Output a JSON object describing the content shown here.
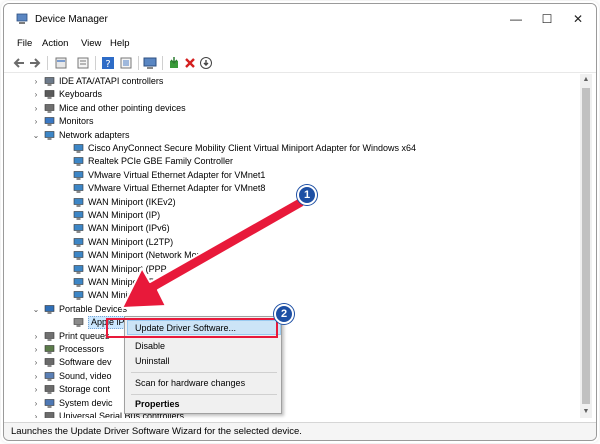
{
  "window": {
    "title": "Device Manager",
    "minimize": "—",
    "maximize": "☐",
    "close": "✕"
  },
  "menu": [
    "File",
    "Action",
    "View",
    "Help"
  ],
  "tree": [
    {
      "label": "IDE ATA/ATAPI controllers",
      "indent": 0,
      "expanded": false,
      "icon": "ide-controller-icon"
    },
    {
      "label": "Keyboards",
      "indent": 0,
      "expanded": false,
      "icon": "keyboard-icon"
    },
    {
      "label": "Mice and other pointing devices",
      "indent": 0,
      "expanded": false,
      "icon": "mouse-icon"
    },
    {
      "label": "Monitors",
      "indent": 0,
      "expanded": false,
      "icon": "monitor-icon"
    },
    {
      "label": "Network adapters",
      "indent": 0,
      "expanded": true,
      "icon": "network-adapter-icon"
    },
    {
      "label": "Cisco AnyConnect Secure Mobility Client Virtual Miniport Adapter for Windows x64",
      "indent": 1,
      "icon": "network-adapter-icon"
    },
    {
      "label": "Realtek PCIe GBE Family Controller",
      "indent": 1,
      "icon": "network-adapter-icon"
    },
    {
      "label": "VMware Virtual Ethernet Adapter for VMnet1",
      "indent": 1,
      "icon": "network-adapter-icon"
    },
    {
      "label": "VMware Virtual Ethernet Adapter for VMnet8",
      "indent": 1,
      "icon": "network-adapter-icon"
    },
    {
      "label": "WAN Miniport (IKEv2)",
      "indent": 1,
      "icon": "network-adapter-icon"
    },
    {
      "label": "WAN Miniport (IP)",
      "indent": 1,
      "icon": "network-adapter-icon"
    },
    {
      "label": "WAN Miniport (IPv6)",
      "indent": 1,
      "icon": "network-adapter-icon"
    },
    {
      "label": "WAN Miniport (L2TP)",
      "indent": 1,
      "icon": "network-adapter-icon"
    },
    {
      "label": "WAN Miniport (Network Monito",
      "indent": 1,
      "icon": "network-adapter-icon"
    },
    {
      "label": "WAN Miniport (PPP",
      "indent": 1,
      "icon": "network-adapter-icon"
    },
    {
      "label": "WAN Miniport (PP",
      "indent": 1,
      "icon": "network-adapter-icon"
    },
    {
      "label": "WAN Miniport (",
      "indent": 1,
      "icon": "network-adapter-icon"
    },
    {
      "label": "Portable Devices",
      "indent": 0,
      "expanded": true,
      "icon": "portable-device-icon"
    },
    {
      "label": "Apple iPh",
      "indent": 1,
      "icon": "phone-icon",
      "selected": true
    },
    {
      "label": "Print queues",
      "indent": 0,
      "expanded": false,
      "icon": "printer-icon"
    },
    {
      "label": "Processors",
      "indent": 0,
      "expanded": false,
      "icon": "processor-icon"
    },
    {
      "label": "Software dev",
      "indent": 0,
      "expanded": false,
      "icon": "software-device-icon"
    },
    {
      "label": "Sound, video",
      "indent": 0,
      "expanded": false,
      "icon": "sound-icon"
    },
    {
      "label": "Storage cont",
      "indent": 0,
      "expanded": false,
      "icon": "storage-icon"
    },
    {
      "label": "System devic",
      "indent": 0,
      "expanded": false,
      "icon": "system-device-icon"
    },
    {
      "label": "Universal Serial Bus controllers",
      "indent": 0,
      "expanded": false,
      "icon": "usb-icon"
    }
  ],
  "context_menu": {
    "update": "Update Driver Software...",
    "disable": "Disable",
    "uninstall": "Uninstall",
    "scan": "Scan for hardware changes",
    "properties": "Properties"
  },
  "annotations": {
    "badge1": "1",
    "badge2": "2"
  },
  "status": "Launches the Update Driver Software Wizard for the selected device.",
  "colors": {
    "highlight": "#e8193a",
    "badge": "#1d4fa4",
    "menu_hover": "#cce4f7"
  }
}
